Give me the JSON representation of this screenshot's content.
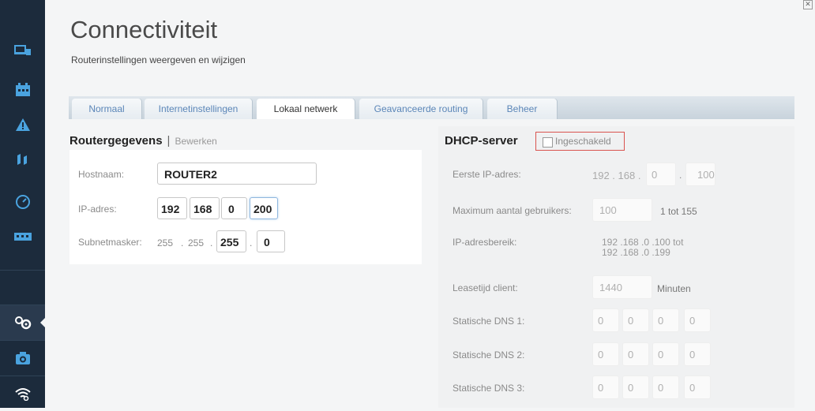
{
  "header": {
    "title": "Connectiviteit",
    "subtitle": "Routerinstellingen weergeven en wijzigen"
  },
  "close_icon": "close-icon",
  "sidebar": {
    "items": [
      {
        "icon": "devices-icon"
      },
      {
        "icon": "calendar-icon"
      },
      {
        "icon": "alert-icon"
      },
      {
        "icon": "priority-icon"
      },
      {
        "icon": "speed-icon"
      },
      {
        "icon": "network-icon"
      },
      {
        "icon": "settings-gears-icon",
        "active": true
      },
      {
        "icon": "camera-icon"
      },
      {
        "icon": "wifi-icon"
      }
    ]
  },
  "tabs": [
    "Normaal",
    "Internetinstellingen",
    "Lokaal netwerk",
    "Geavanceerde routing",
    "Beheer"
  ],
  "active_tab": "Lokaal netwerk",
  "router": {
    "section_title": "Routergegevens",
    "separator": "|",
    "edit_label": "Bewerken",
    "hostname_label": "Hostnaam:",
    "hostname": "ROUTER2",
    "ip_label": "IP-adres:",
    "ip": [
      "192",
      "168",
      "0",
      "200"
    ],
    "subnet_label": "Subnetmasker:",
    "subnet_fixed": [
      "255",
      "255"
    ],
    "subnet_edit": [
      "255",
      "0"
    ],
    "dot": "."
  },
  "dhcp": {
    "section_title": "DHCP-server",
    "enabled_label": "Ingeschakeld",
    "enabled": false,
    "first_ip_label": "Eerste IP-adres:",
    "first_ip_fixed": "192 . 168 .",
    "first_ip_3": "0",
    "first_ip_dot": ".",
    "first_ip_4": "100",
    "max_users_label": "Maximum aantal gebruikers:",
    "max_users": "100",
    "max_users_range": "1 tot 155",
    "range_label": "IP-adresbereik:",
    "range_line1": "192 .168 .0 .100  tot",
    "range_line2": "192 .168 .0 .199",
    "lease_label": "Leasetijd client:",
    "lease": "1440",
    "lease_unit": "Minuten",
    "dns1_label": "Statische DNS 1:",
    "dns2_label": "Statische DNS 2:",
    "dns3_label": "Statische DNS 3:",
    "dns1": [
      "0",
      "0",
      "0",
      "0"
    ],
    "dns2": [
      "0",
      "0",
      "0",
      "0"
    ],
    "dns3": [
      "0",
      "0",
      "0",
      "0"
    ]
  },
  "colors": {
    "rail": "#1c2b3c",
    "tab_link": "#5b86b8",
    "highlight_box": "#d9534f"
  }
}
